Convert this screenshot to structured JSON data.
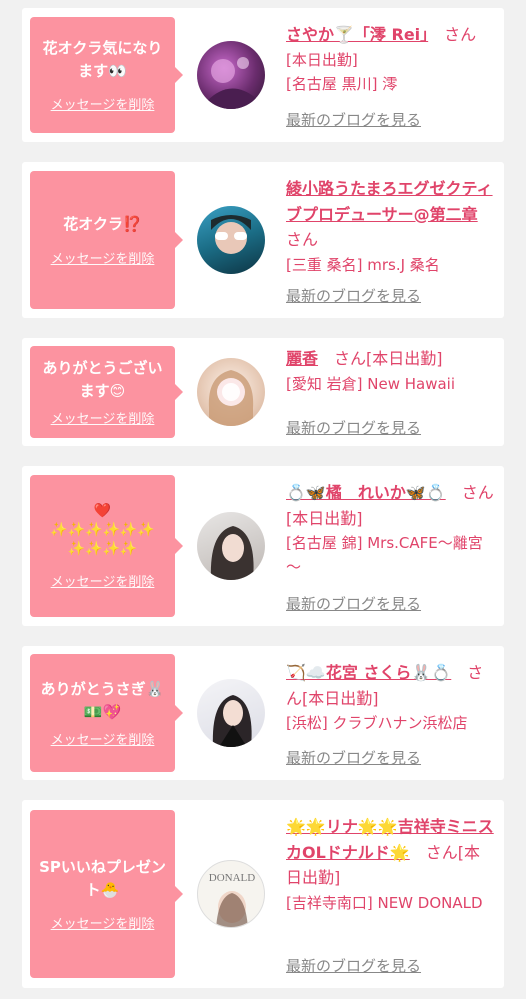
{
  "cards": [
    {
      "message": "花オクラ気になります👀",
      "delete_label": "メッセージを削除",
      "name": "さやか🍸「澪 Rei」",
      "honorific": "さん",
      "status": "[本日出勤]",
      "shop": "[名古屋 黒川] 澪",
      "blog_link": "最新のブログを見る",
      "avatar_icon": "profile-photo"
    },
    {
      "message": "花オクラ⁉️",
      "delete_label": "メッセージを削除",
      "name": "綾小路うたまろエグゼクティブプロデューサー@第二章",
      "honorific": "さん",
      "status": "",
      "shop": "[三重 桑名] mrs.J 桑名",
      "blog_link": "最新のブログを見る",
      "avatar_icon": "profile-photo"
    },
    {
      "message": "ありがとうございます😊",
      "delete_label": "メッセージを削除",
      "name": "麗香",
      "honorific": "さん",
      "status": "[本日出勤]",
      "shop": "[愛知 岩倉] New Hawaii",
      "blog_link": "最新のブログを見る",
      "avatar_icon": "profile-photo"
    },
    {
      "message": "❤️\n✨✨✨✨✨✨\n✨✨✨✨",
      "delete_label": "メッセージを削除",
      "name": "💍🦋橘　れいか🦋💍",
      "honorific": "さん",
      "status": "[本日出勤]",
      "shop": "[名古屋 錦] Mrs.CAFE～離宮～",
      "blog_link": "最新のブログを見る",
      "avatar_icon": "profile-photo"
    },
    {
      "message": "ありがとうさぎ🐰💵💖",
      "delete_label": "メッセージを削除",
      "name": "🏹☁️花宮 さくら🐰💍",
      "honorific": "さん",
      "status": "[本日出勤]",
      "shop": "[浜松] クラブハナン浜松店",
      "blog_link": "最新のブログを見る",
      "avatar_icon": "profile-photo"
    },
    {
      "message": "SPいいねプレゼント🐣",
      "delete_label": "メッセージを削除",
      "name": "🌟🌟リナ🌟🌟吉祥寺ミニスカOLドナルド🌟",
      "honorific": "さん",
      "status": "[本日出勤]",
      "shop": "[吉祥寺南口] NEW DONALD",
      "blog_link": "最新のブログを見る",
      "avatar_icon": "shop-logo-photo",
      "avatar_text": "DONALD"
    }
  ]
}
